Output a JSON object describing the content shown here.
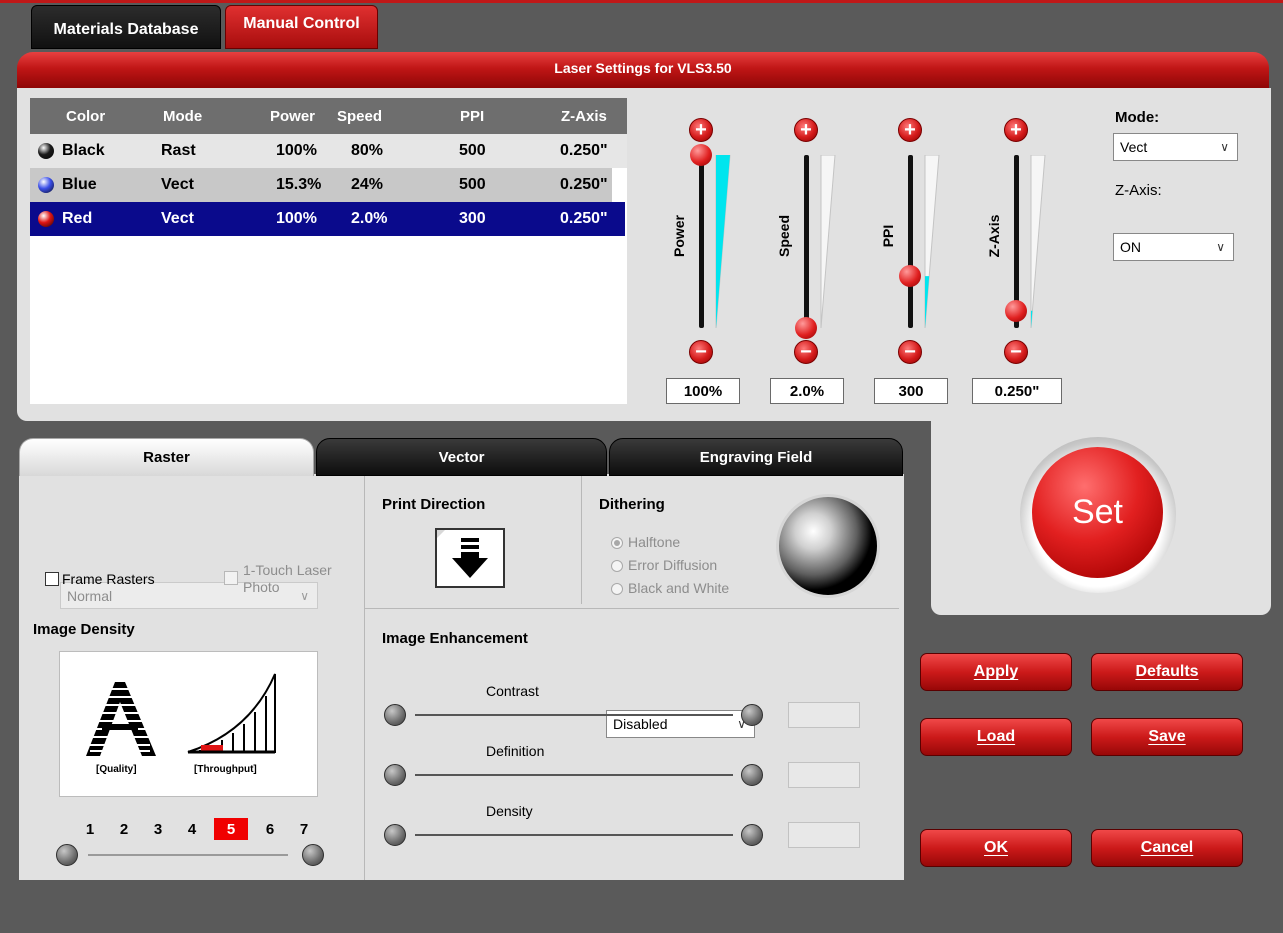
{
  "tabs": {
    "materials": "Materials Database",
    "manual": "Manual Control"
  },
  "header": {
    "title": "Laser Settings for VLS3.50"
  },
  "table": {
    "headers": [
      "Color",
      "Mode",
      "Power",
      "Speed",
      "PPI",
      "Z-Axis"
    ],
    "rows": [
      {
        "color": "Black",
        "mode": "Rast",
        "power": "100%",
        "speed": "80%",
        "ppi": "500",
        "zaxis": "0.250\""
      },
      {
        "color": "Blue",
        "mode": "Vect",
        "power": "15.3%",
        "speed": "24%",
        "ppi": "500",
        "zaxis": "0.250\""
      },
      {
        "color": "Red",
        "mode": "Vect",
        "power": "100%",
        "speed": "2.0%",
        "ppi": "300",
        "zaxis": "0.250\""
      }
    ],
    "selected_row": 2,
    "row_ball_colors": [
      "#1a1a1a",
      "#3a4ee8",
      "#e01414"
    ]
  },
  "sliders": [
    {
      "label": "Power",
      "value": "100%",
      "level": 1.0
    },
    {
      "label": "Speed",
      "value": "2.0%",
      "level": 0.0
    },
    {
      "label": "PPI",
      "value": "300",
      "level": 0.3
    },
    {
      "label": "Z-Axis",
      "value": "0.250\"",
      "level": 0.1
    }
  ],
  "mode": {
    "label": "Mode:",
    "value": "Vect"
  },
  "zaxis": {
    "label": "Z-Axis:",
    "value": "ON"
  },
  "set_button": "Set",
  "subtabs": {
    "raster": "Raster",
    "vector": "Vector",
    "engraving": "Engraving Field"
  },
  "raster": {
    "raster_type": "Normal",
    "frame_rasters": "Frame Rasters",
    "one_touch_line1": "1-Touch Laser",
    "one_touch_line2": "Photo",
    "image_density_label": "Image Density",
    "quality": "[Quality]",
    "throughput": "[Throughput]",
    "density_scale": [
      "1",
      "2",
      "3",
      "4",
      "5",
      "6",
      "7"
    ],
    "density_selected": 4
  },
  "print_direction": {
    "label": "Print Direction"
  },
  "dithering": {
    "label": "Dithering",
    "options": [
      "Halftone",
      "Error Diffusion",
      "Black and White"
    ],
    "selected": 0
  },
  "enhancement": {
    "label": "Image Enhancement",
    "value": "Disabled",
    "sliders": [
      "Contrast",
      "Definition",
      "Density"
    ]
  },
  "buttons": {
    "apply": "Apply",
    "defaults": "Defaults",
    "load": "Load",
    "save": "Save",
    "ok": "OK",
    "cancel": "Cancel"
  },
  "colors": {
    "accent": "#c01616",
    "selected_row": "#0a0a8c",
    "slider_fill": "#00e5ee"
  }
}
